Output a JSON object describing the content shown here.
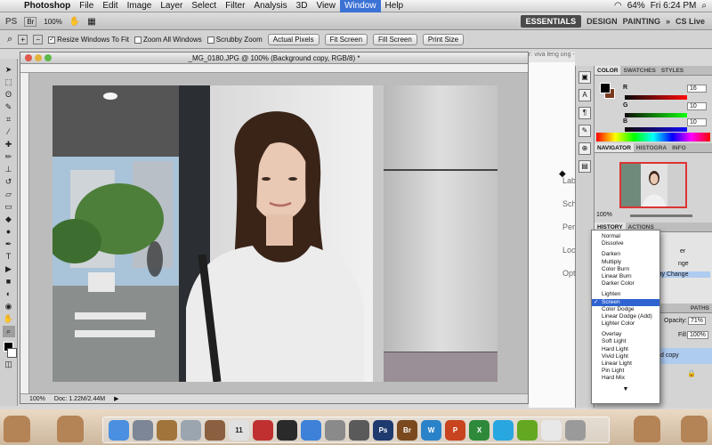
{
  "menubar": {
    "app": "Photoshop",
    "items": [
      "File",
      "Edit",
      "Image",
      "Layer",
      "Select",
      "Filter",
      "Analysis",
      "3D",
      "View",
      "Window",
      "Help"
    ],
    "active": "Window",
    "battery": "64%",
    "clock": "Fri 6:24 PM"
  },
  "appbar": {
    "ps": "PS",
    "zoom": "100%",
    "workspaces": [
      "ESSENTIALS",
      "DESIGN",
      "PAINTING"
    ],
    "cs_live": "CS Live"
  },
  "options": {
    "resize": "Resize Windows To Fit",
    "zoom_all": "Zoom All Windows",
    "scrubby": "Scrubby Zoom",
    "actual": "Actual Pixels",
    "fit": "Fit Screen",
    "fill": "Fill Screen",
    "print": "Print Size"
  },
  "document": {
    "title": "_MG_0180.JPG @ 100% (Background copy, RGB/8) *",
    "zoom": "100%",
    "doc_size": "Doc: 1.22M/2.44M"
  },
  "web_peek": {
    "tab": "r: viva leng ong - Create post",
    "rows": [
      "Labels",
      "Sched",
      "Perm",
      "Loca",
      "Optio"
    ]
  },
  "color_panel": {
    "tabs": [
      "COLOR",
      "SWATCHES",
      "STYLES"
    ],
    "r": "16",
    "g": "10",
    "b": "10"
  },
  "navigator": {
    "tabs": [
      "NAVIGATOR",
      "HISTOGRA",
      "INFO"
    ],
    "zoom": "100%"
  },
  "history": {
    "tabs": [
      "HISTORY",
      "ACTIONS"
    ],
    "items": [
      "er",
      "nge",
      "ity Change"
    ]
  },
  "layers": {
    "tabs": [
      "PATHS"
    ],
    "opacity_label": "Opacity:",
    "opacity": "71%",
    "fill_label": "Fill:",
    "fill": "100%",
    "layer_name": "d copy"
  },
  "blend_modes": {
    "groups": [
      [
        "Normal",
        "Dissolve"
      ],
      [
        "Darken",
        "Multiply",
        "Color Burn",
        "Linear Burn",
        "Darker Color"
      ],
      [
        "Lighten",
        "Screen",
        "Color Dodge",
        "Linear Dodge (Add)",
        "Lighter Color"
      ],
      [
        "Overlay",
        "Soft Light",
        "Hard Light",
        "Vivid Light",
        "Linear Light",
        "Pin Light",
        "Hard Mix"
      ]
    ],
    "selected": "Screen"
  },
  "dock": {
    "icons": [
      {
        "name": "finder",
        "label": "",
        "color": "#4a8fe0"
      },
      {
        "name": "rocket",
        "label": "",
        "color": "#7c8696"
      },
      {
        "name": "preview",
        "label": "",
        "color": "#a0743a"
      },
      {
        "name": "mail",
        "label": "",
        "color": "#9aa5b0"
      },
      {
        "name": "photo",
        "label": "",
        "color": "#8a6040"
      },
      {
        "name": "ical",
        "label": "11",
        "color": "#e0e0e0"
      },
      {
        "name": "stamp",
        "label": "",
        "color": "#c03030"
      },
      {
        "name": "dashboard",
        "label": "",
        "color": "#2a2a2a"
      },
      {
        "name": "appstore",
        "label": "",
        "color": "#3d82d8"
      },
      {
        "name": "prefs",
        "label": "",
        "color": "#8a8a8a"
      },
      {
        "name": "dvd",
        "label": "",
        "color": "#5a5a5a"
      },
      {
        "name": "photoshop",
        "label": "Ps",
        "color": "#1e3a6e"
      },
      {
        "name": "bridge",
        "label": "Br",
        "color": "#7a4a1e"
      },
      {
        "name": "wordpress",
        "label": "W",
        "color": "#2a82c8"
      },
      {
        "name": "powerpoint",
        "label": "P",
        "color": "#c8441e"
      },
      {
        "name": "excel",
        "label": "X",
        "color": "#2e8a3a"
      },
      {
        "name": "skype",
        "label": "",
        "color": "#28a6e0"
      },
      {
        "name": "spotify",
        "label": "",
        "color": "#63a820"
      },
      {
        "name": "textedit",
        "label": "",
        "color": "#e8e8e8"
      },
      {
        "name": "trash",
        "label": "",
        "color": "#9a9a9a"
      }
    ]
  }
}
